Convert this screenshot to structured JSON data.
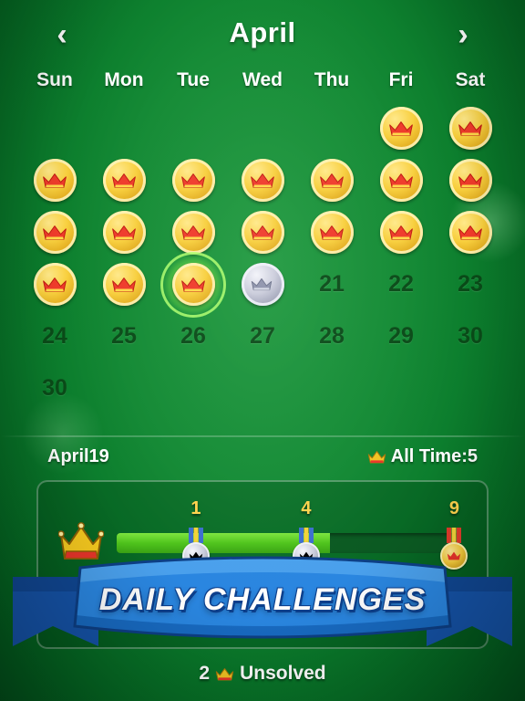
{
  "header": {
    "month_title": "April",
    "prev_label": "‹",
    "next_label": "›"
  },
  "weekdays": [
    "Sun",
    "Mon",
    "Tue",
    "Wed",
    "Thu",
    "Fri",
    "Sat"
  ],
  "calendar": {
    "rows": [
      [
        {
          "type": "empty",
          "label": ""
        },
        {
          "type": "empty",
          "label": ""
        },
        {
          "type": "empty",
          "label": ""
        },
        {
          "type": "empty",
          "label": ""
        },
        {
          "type": "empty",
          "label": ""
        },
        {
          "type": "crown",
          "label": ""
        },
        {
          "type": "crown",
          "label": ""
        }
      ],
      [
        {
          "type": "crown",
          "label": ""
        },
        {
          "type": "crown",
          "label": ""
        },
        {
          "type": "crown",
          "label": ""
        },
        {
          "type": "crown",
          "label": ""
        },
        {
          "type": "crown",
          "label": ""
        },
        {
          "type": "crown",
          "label": ""
        },
        {
          "type": "crown",
          "label": ""
        }
      ],
      [
        {
          "type": "crown",
          "label": ""
        },
        {
          "type": "crown",
          "label": ""
        },
        {
          "type": "crown",
          "label": ""
        },
        {
          "type": "crown",
          "label": ""
        },
        {
          "type": "crown",
          "label": ""
        },
        {
          "type": "crown",
          "label": ""
        },
        {
          "type": "crown",
          "label": ""
        }
      ],
      [
        {
          "type": "crown",
          "label": ""
        },
        {
          "type": "crown",
          "label": ""
        },
        {
          "type": "crown",
          "label": "",
          "selected": true
        },
        {
          "type": "silver",
          "label": ""
        },
        {
          "type": "number",
          "label": "21"
        },
        {
          "type": "number",
          "label": "22"
        },
        {
          "type": "number",
          "label": "23"
        }
      ],
      [
        {
          "type": "number",
          "label": "24"
        },
        {
          "type": "number",
          "label": "25"
        },
        {
          "type": "number",
          "label": "26"
        },
        {
          "type": "number",
          "label": "27"
        },
        {
          "type": "number",
          "label": "28"
        },
        {
          "type": "number",
          "label": "29"
        },
        {
          "type": "number",
          "label": "30"
        }
      ],
      [
        {
          "type": "number",
          "label": "30"
        },
        {
          "type": "empty",
          "label": ""
        },
        {
          "type": "empty",
          "label": ""
        },
        {
          "type": "empty",
          "label": ""
        },
        {
          "type": "empty",
          "label": ""
        },
        {
          "type": "empty",
          "label": ""
        },
        {
          "type": "empty",
          "label": ""
        }
      ]
    ]
  },
  "stats": {
    "date_label": "April19",
    "all_time_label": "All Time:5"
  },
  "progress": {
    "tiers": [
      {
        "label": "1",
        "pos_pct": 23
      },
      {
        "label": "4",
        "pos_pct": 55
      },
      {
        "label": "9",
        "pos_pct": 98
      }
    ],
    "fill_pct": 62
  },
  "banner": {
    "text": "DAILY CHALLENGES"
  },
  "footer": {
    "unsolved_count": "2",
    "unsolved_label": "Unsolved"
  },
  "colors": {
    "background_green": "#0a7a2b",
    "gold": "#f8cf3d",
    "crown_red": "#e8352a",
    "banner_blue": "#1f6fd0",
    "tier_yellow": "#ffd34d",
    "track_fill_green": "#4fc41c"
  }
}
